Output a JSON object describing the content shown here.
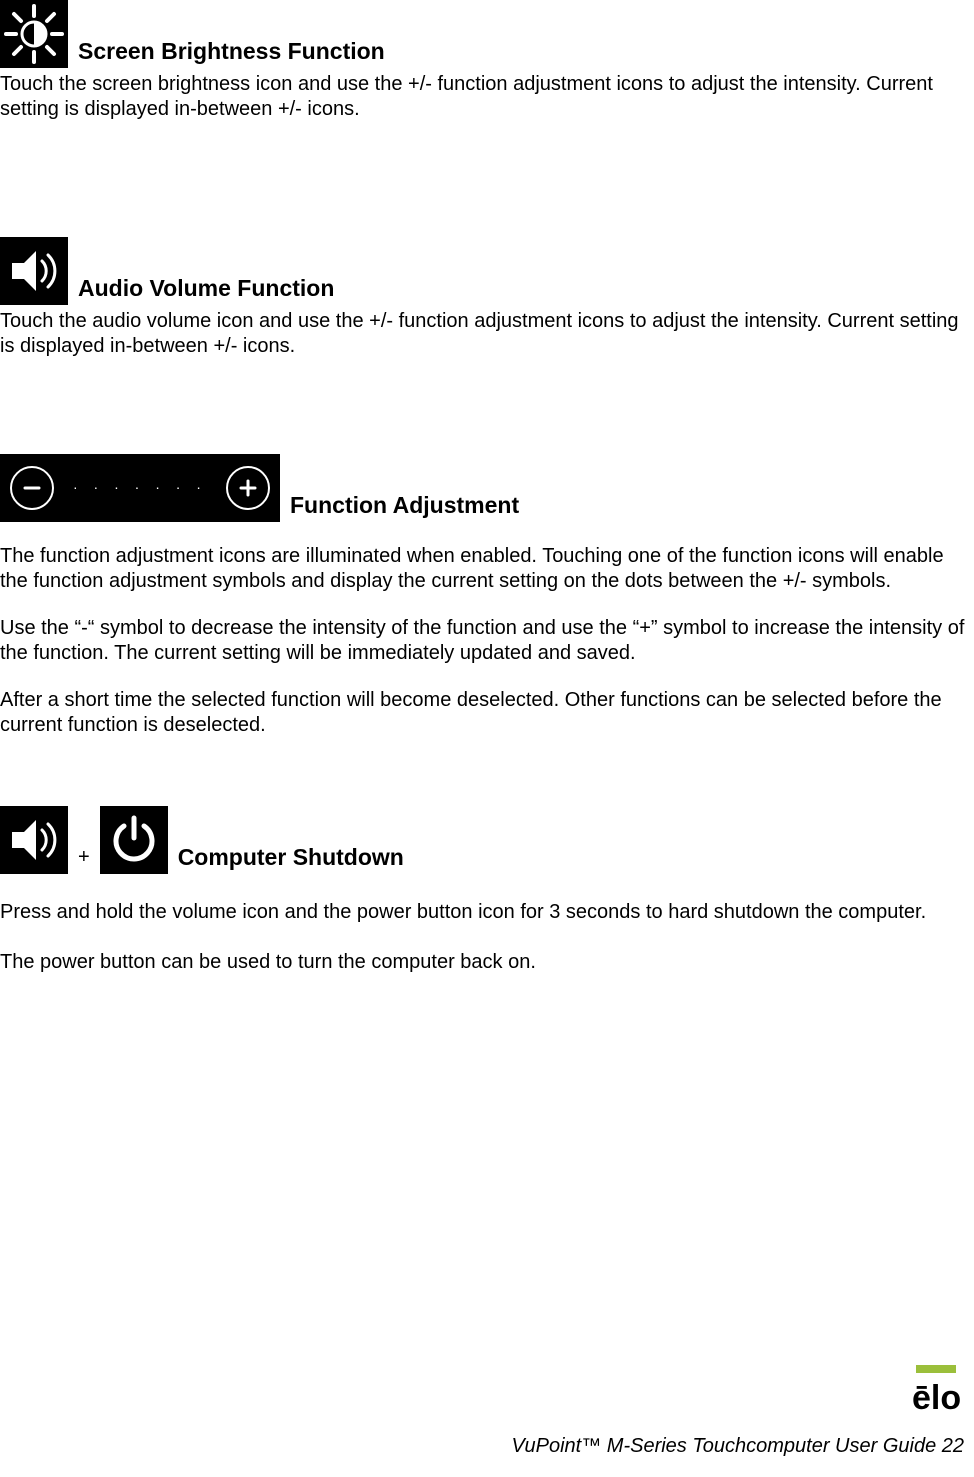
{
  "sections": {
    "brightness": {
      "heading": "Screen Brightness Function",
      "body": "Touch the screen brightness icon and use the +/- function adjustment icons to adjust the intensity. Current setting is displayed in-between +/- icons."
    },
    "volume": {
      "heading": "Audio Volume Function",
      "body": "Touch the audio volume icon and use the +/- function adjustment icons to adjust the intensity. Current setting is displayed in-between +/- icons."
    },
    "adjust": {
      "heading": "Function Adjustment",
      "p1": "The function adjustment icons are illuminated when enabled.  Touching one of the function icons will enable the function adjustment symbols and display the current setting on the dots between the +/- symbols.",
      "p2": "Use the “-“ symbol to decrease the intensity of the function and use the “+” symbol to increase the intensity of the function.  The current setting will be immediately updated and saved.",
      "p3": "After a short time the selected function will become deselected.  Other functions can be selected before the current function is deselected."
    },
    "shutdown": {
      "plus": "+",
      "heading": "Computer Shutdown",
      "p1": "Press and hold the volume icon and the power button icon for 3 seconds to hard shutdown the computer.",
      "p2": "The power button can be used to turn the computer back on."
    }
  },
  "adjust_control": {
    "minus": "−",
    "plus": "+",
    "dots": "· · · · · · ·"
  },
  "footer": {
    "text": "VuPoint™ M-Series Touchcomputer User Guide 22",
    "logo_text": "elo"
  }
}
